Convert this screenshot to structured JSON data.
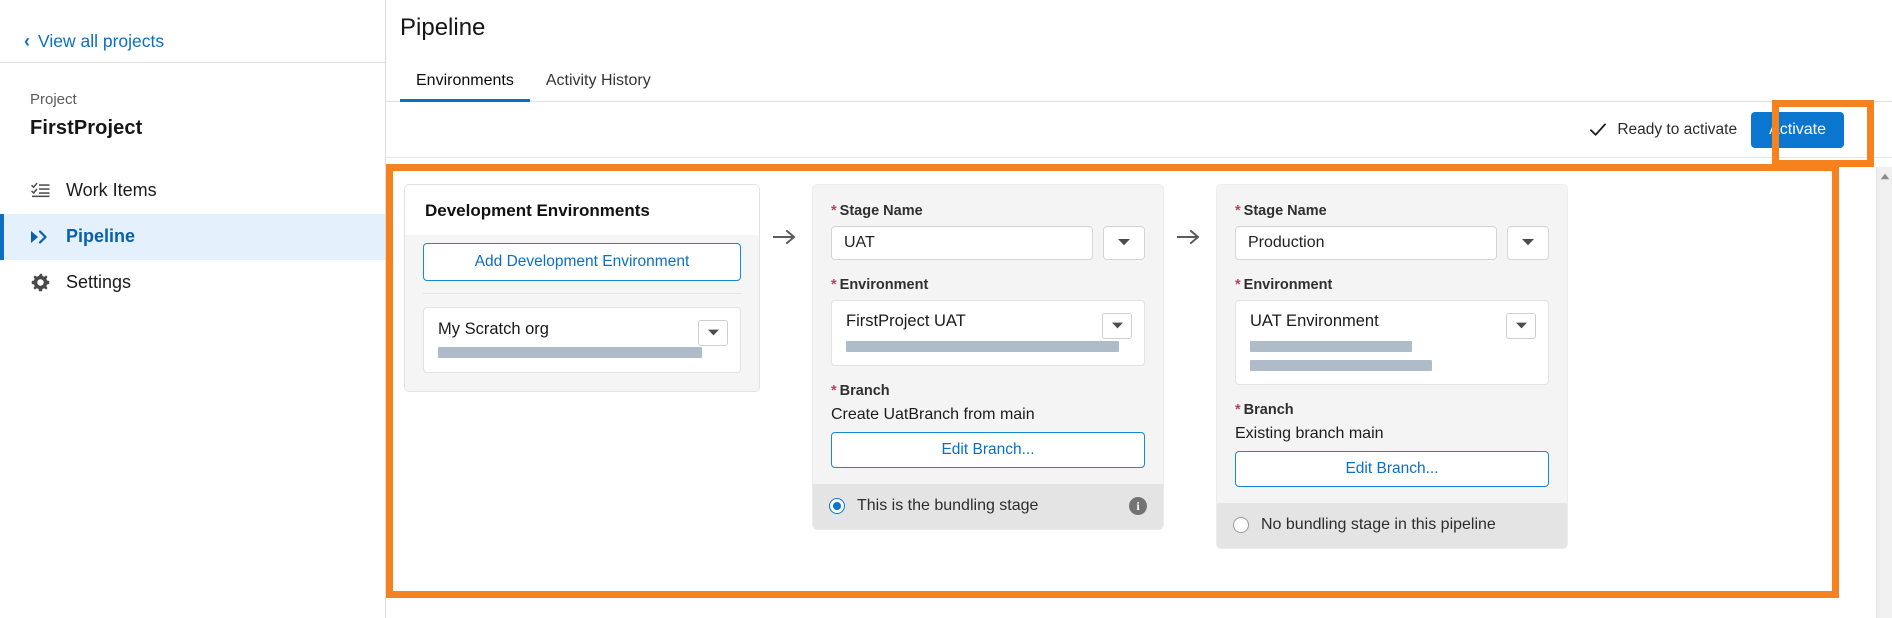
{
  "sidebar": {
    "back_link": "View all projects",
    "back_icon": "chevron-left-icon",
    "project_kicker": "Project",
    "project_name": "FirstProject",
    "nav_items": [
      {
        "label": "Work Items",
        "icon": "checklist-icon",
        "active": false
      },
      {
        "label": "Pipeline",
        "icon": "double-chevron-right-icon",
        "active": true
      },
      {
        "label": "Settings",
        "icon": "gear-icon",
        "active": false
      }
    ]
  },
  "main": {
    "page_title": "Pipeline",
    "tabs": [
      {
        "label": "Environments",
        "active": true
      },
      {
        "label": "Activity History",
        "active": false
      }
    ],
    "action_bar": {
      "status_icon": "check-icon",
      "status_text": "Ready to activate",
      "activate_label": "Activate"
    }
  },
  "pipeline": {
    "arrow_icon": "arrow-right-icon",
    "dev_card": {
      "title": "Development Environments",
      "add_button": "Add Development Environment",
      "environment": {
        "name": "My Scratch org",
        "dropdown_icon": "caret-down-icon",
        "redacted": true
      }
    },
    "stages": [
      {
        "stage_name_label": "Stage Name",
        "stage_name_value": "UAT",
        "stage_name_dropdown_icon": "caret-down-icon",
        "environment_label": "Environment",
        "environment_value": "FirstProject UAT",
        "environment_dropdown_icon": "caret-down-icon",
        "environment_redacted_lines": 1,
        "branch_label": "Branch",
        "branch_text": "Create UatBranch from main",
        "edit_branch_label": "Edit Branch...",
        "bundling_label": "This is the bundling stage",
        "bundling_selected": true,
        "info_icon": "info-icon",
        "info_glyph": "i"
      },
      {
        "stage_name_label": "Stage Name",
        "stage_name_value": "Production",
        "stage_name_dropdown_icon": "caret-down-icon",
        "environment_label": "Environment",
        "environment_value": "UAT Environment",
        "environment_dropdown_icon": "caret-down-icon",
        "environment_redacted_lines": 2,
        "branch_label": "Branch",
        "branch_text": "Existing branch main",
        "edit_branch_label": "Edit Branch...",
        "bundling_label": "No bundling stage in this pipeline",
        "bundling_selected": false,
        "info_icon": null,
        "info_glyph": ""
      }
    ]
  },
  "annotations": {
    "highlight_color": "#f5821f",
    "boxes": [
      "pipeline-canvas",
      "activate-button"
    ]
  },
  "scrollbar": {
    "up_arrow_icon": "triangle-up-icon"
  },
  "colors": {
    "accent_blue": "#0b6fc4",
    "button_blue": "#0b76cf",
    "highlight_orange": "#f5821f",
    "required_red": "#b3455b",
    "redaction_gray": "#aebcc9"
  }
}
